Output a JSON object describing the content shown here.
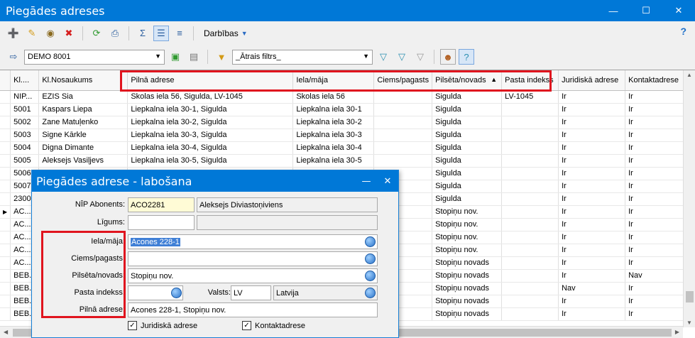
{
  "window": {
    "title": "Piegādes adreses"
  },
  "toolbar": {
    "darbibas_label": "Darbības",
    "help_label": "?"
  },
  "filterbar": {
    "database": "DEMO 8001",
    "quick_filter": "_Ātrais filtrs_"
  },
  "grid": {
    "columns": [
      "Kl....",
      "Kl.Nosaukums",
      "Pilnā adrese",
      "Iela/māja",
      "Ciems/pagasts",
      "Pilsēta/novads",
      "Pasta indekss",
      "Juridiskā adrese",
      "Kontaktadrese"
    ],
    "rows": [
      [
        "NIP...",
        "EZIS Sia",
        "Skolas iela 56, Sigulda, LV-1045",
        "Skolas iela 56",
        "",
        "Sigulda",
        "LV-1045",
        "Ir",
        "Ir"
      ],
      [
        "5001",
        "Kaspars Liepa",
        "Liepkalna iela 30-1, Sigulda",
        "Liepkalna iela 30-1",
        "",
        "Sigulda",
        "",
        "Ir",
        "Ir"
      ],
      [
        "5002",
        "Zane Matuļenko",
        "Liepkalna iela 30-2, Sigulda",
        "Liepkalna iela 30-2",
        "",
        "Sigulda",
        "",
        "Ir",
        "Ir"
      ],
      [
        "5003",
        "Signe Kārkle",
        "Liepkalna iela 30-3, Sigulda",
        "Liepkalna iela 30-3",
        "",
        "Sigulda",
        "",
        "Ir",
        "Ir"
      ],
      [
        "5004",
        "Digna Dimante",
        "Liepkalna iela 30-4, Sigulda",
        "Liepkalna iela 30-4",
        "",
        "Sigulda",
        "",
        "Ir",
        "Ir"
      ],
      [
        "5005",
        "Aleksejs Vasiļjevs",
        "Liepkalna iela 30-5, Sigulda",
        "Liepkalna iela 30-5",
        "",
        "Sigulda",
        "",
        "Ir",
        "Ir"
      ],
      [
        "5006",
        "",
        "",
        "",
        "",
        "Sigulda",
        "",
        "Ir",
        "Ir"
      ],
      [
        "5007",
        "",
        "",
        "",
        "",
        "Sigulda",
        "",
        "Ir",
        "Ir"
      ],
      [
        "2300",
        "",
        "",
        "",
        "",
        "Sigulda",
        "",
        "Ir",
        "Ir"
      ],
      [
        "AC...",
        "",
        "",
        "",
        "",
        "Stopiņu nov.",
        "",
        "Ir",
        "Ir"
      ],
      [
        "AC...",
        "",
        "",
        "",
        "",
        "Stopiņu nov.",
        "",
        "Ir",
        "Ir"
      ],
      [
        "AC...",
        "",
        "",
        "",
        "",
        "Stopiņu nov.",
        "",
        "Ir",
        "Ir"
      ],
      [
        "AC...",
        "",
        "",
        "",
        "",
        "Stopiņu nov.",
        "",
        "Ir",
        "Ir"
      ],
      [
        "AC...",
        "",
        "",
        "",
        "",
        "Stopiņu novads",
        "",
        "Ir",
        "Ir"
      ],
      [
        "BEB...",
        "",
        "",
        "",
        "",
        "Stopiņu novads",
        "",
        "Ir",
        "Nav"
      ],
      [
        "BEB...",
        "",
        "",
        "",
        "",
        "Stopiņu novads",
        "",
        "Nav",
        "Ir"
      ],
      [
        "BEB...",
        "",
        "",
        "",
        "",
        "Stopiņu novads",
        "",
        "Ir",
        "Ir"
      ],
      [
        "BEB...",
        "",
        "",
        "",
        "",
        "Stopiņu novads",
        "",
        "Ir",
        "Ir"
      ]
    ]
  },
  "dialog": {
    "title": "Piegādes adrese - labošana",
    "labels": {
      "abonents": "NĪP Abonents:",
      "ligums": "Līgums:",
      "iela": "Iela/māja:",
      "ciems": "Ciems/pagasts:",
      "pilseta": "Pilsēta/novads:",
      "pasta": "Pasta indekss:",
      "valsts": "Valsts:",
      "pilna": "Pilnā adrese:"
    },
    "values": {
      "abonents_code": "ACO2281",
      "abonents_name": "Aleksejs Diviastoņiviens",
      "ligums": "",
      "iela": "Acones 228-1",
      "ciems": "",
      "pilseta": "Stopiņu nov.",
      "pasta": "",
      "valsts_code": "LV",
      "valsts_name": "Latvija",
      "pilna": "Acones 228-1, Stopiņu nov."
    },
    "checkboxes": {
      "juridiska": "Juridiskā adrese",
      "kontakt": "Kontaktadrese"
    }
  }
}
